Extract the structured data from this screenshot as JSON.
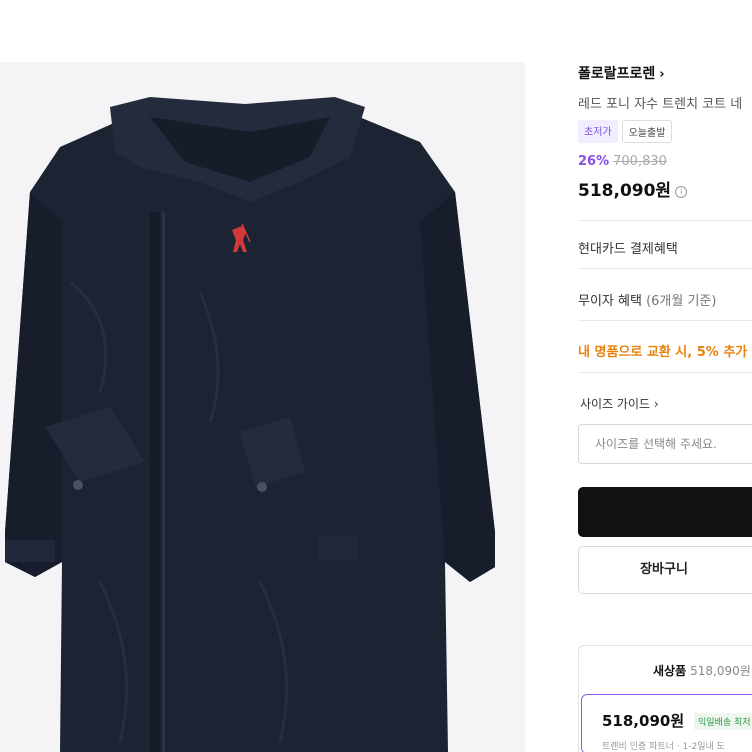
{
  "product": {
    "image_icon": "navy-trench-coat-photo",
    "brand": "폴로랄프로렌",
    "brand_chevron": "›",
    "title": "레드 포니 자수 트렌치 코트 네",
    "badges": [
      "초저가",
      "오늘출발"
    ],
    "discount": "26%",
    "original_price": "700,830",
    "price": "518,090원",
    "price_info_icon": "i"
  },
  "benefits": {
    "card": "현대카드 결제혜택",
    "installment": "무이자 혜택",
    "installment_detail": "(6개월 기준)",
    "trade_in": "내 명품으로 교환 시, 5% 추가"
  },
  "size": {
    "guide_label": "사이즈 가이드",
    "guide_chevron": "›",
    "placeholder": "사이즈를 선택해 주세요."
  },
  "actions": {
    "buy_label": "",
    "cart_label": "장바구니"
  },
  "offers": {
    "tab_label": "새상품",
    "tab_price": "518,090원",
    "price": "518,090원",
    "tag": "익일배송 최저",
    "seller": "트렌비 인증 파트너 · 1-2일내 도"
  },
  "colors": {
    "accent_purple": "#8a4fe8",
    "promo_orange": "#e8820c",
    "coat_navy": "#1c2333"
  }
}
